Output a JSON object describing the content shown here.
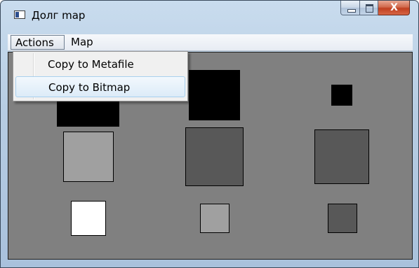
{
  "window": {
    "title": "Долг map"
  },
  "caption_buttons": {
    "minimize_icon": "minimize-icon",
    "maximize_icon": "maximize-icon",
    "close_icon": "close-icon",
    "close_glyph": "X"
  },
  "menubar": {
    "items": [
      {
        "label": "Actions",
        "state": "open"
      },
      {
        "label": "Map"
      }
    ]
  },
  "actions_menu": {
    "items": [
      {
        "label": "Copy to Metafile"
      },
      {
        "label": "Copy to Bitmap",
        "state": "hovered"
      }
    ]
  },
  "canvas": {
    "background": "#808080",
    "squares": [
      {
        "row": 1,
        "column": 1,
        "fill": "#000000"
      },
      {
        "row": 1,
        "column": 2,
        "fill": "#000000"
      },
      {
        "row": 1,
        "column": 3,
        "fill": "#000000"
      },
      {
        "row": 2,
        "column": 1,
        "fill": "#a0a0a0"
      },
      {
        "row": 2,
        "column": 2,
        "fill": "#585858"
      },
      {
        "row": 2,
        "column": 3,
        "fill": "#585858"
      },
      {
        "row": 3,
        "column": 1,
        "fill": "#ffffff"
      },
      {
        "row": 3,
        "column": 2,
        "fill": "#a0a0a0"
      },
      {
        "row": 3,
        "column": 3,
        "fill": "#585858"
      }
    ]
  }
}
